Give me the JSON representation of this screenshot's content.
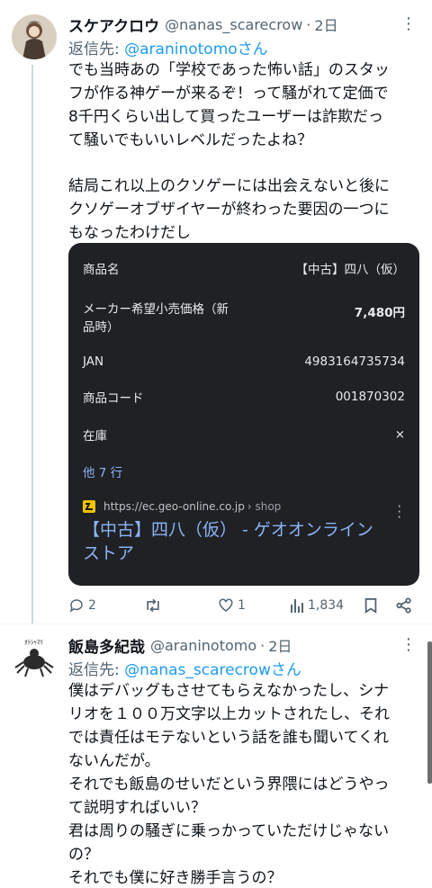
{
  "tweet1": {
    "display_name": "スケアクロウ",
    "handle": "@nanas_scarecrow",
    "time": "2日",
    "reply_prefix": "返信先: ",
    "reply_mention": "@araninotomoさん",
    "lines": [
      "でも当時あの「学校であった怖い話」のスタッ",
      "フが作る神ゲーが来るぞ！って騒がれて定価で",
      "8千円くらい出して買ったユーザーは詐欺だっ",
      "て騒いでもいいレベルだったよね？",
      "",
      "結局これ以上のクソゲーには出会えないと後に",
      "クソゲーオブザイヤーが終わった要因の一つに",
      "もなったわけだし"
    ],
    "card": {
      "rows": [
        {
          "key": "商品名",
          "value": "【中古】四八（仮）"
        },
        {
          "key": "メーカー希望小売価格（新",
          "key2": "品時）",
          "value": "7,480円"
        },
        {
          "key": "JAN",
          "value": "4983164735734"
        },
        {
          "key": "商品コード",
          "value": "001870302"
        },
        {
          "key": "在庫",
          "value": "×"
        }
      ],
      "more_rows": "他 7 行",
      "source_url": "https://ec.geo-online.co.jp",
      "source_path": "› shop",
      "result_title_1": "【中古】四八（仮） - ゲオオンライン",
      "result_title_2": "ストア"
    },
    "stats": {
      "replies": "2",
      "retweets": "",
      "likes": "1",
      "views": "1,834"
    }
  },
  "tweet2": {
    "display_name": "飯島多紀哉",
    "handle": "@araninotomo",
    "time": "2日",
    "reply_prefix": "返信先: ",
    "reply_mention": "@nanas_scarecrowさん",
    "lines": [
      "僕はデバッグもさせてもらえなかったし、シナ",
      "リオを１００万文字以上カットされたし、それ",
      "では責任はモテないという話を誰も聞いてくれ",
      "ないんだが。",
      "それでも飯島のせいだという界隈にはどうやっ",
      "て説明すればいい？",
      "君は周りの騒ぎに乗っかっていただけじゃない",
      "の？",
      "それでも僕に好き勝手言うの？"
    ]
  },
  "colors": {
    "accent": "#1d9bf0",
    "muted": "#536471",
    "card_bg": "#202124",
    "card_link": "#8ab4f8"
  }
}
